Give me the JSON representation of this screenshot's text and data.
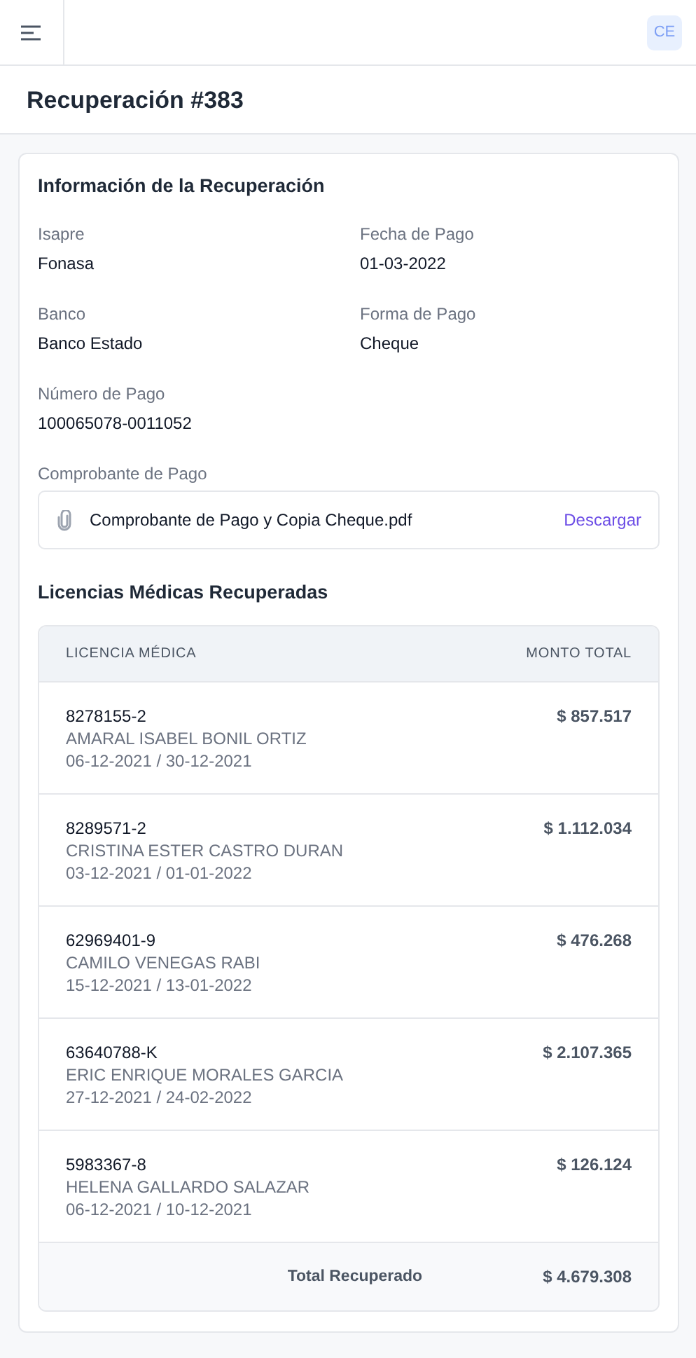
{
  "header": {
    "avatar": "CE"
  },
  "page_title": "Recuperación #383",
  "info": {
    "title": "Información de la Recuperación",
    "fields": [
      {
        "label": "Isapre",
        "value": "Fonasa"
      },
      {
        "label": "Fecha de Pago",
        "value": "01-03-2022"
      },
      {
        "label": "Banco",
        "value": "Banco Estado"
      },
      {
        "label": "Forma de Pago",
        "value": "Cheque"
      },
      {
        "label": "Número de Pago",
        "value": "100065078-0011052"
      }
    ],
    "attachment": {
      "label": "Comprobante de Pago",
      "file": "Comprobante de Pago y Copia Cheque.pdf",
      "action": "Descargar"
    }
  },
  "licenses": {
    "title": "Licencias Médicas Recuperadas",
    "columns": [
      "LICENCIA MÉDICA",
      "MONTO TOTAL"
    ],
    "rows": [
      {
        "id": "8278155-2",
        "name": "AMARAL ISABEL BONIL ORTIZ",
        "dates": "06-12-2021 / 30-12-2021",
        "amount": "$ 857.517"
      },
      {
        "id": "8289571-2",
        "name": "CRISTINA ESTER CASTRO DURAN",
        "dates": "03-12-2021 / 01-01-2022",
        "amount": "$ 1.112.034"
      },
      {
        "id": "62969401-9",
        "name": "CAMILO VENEGAS RABI",
        "dates": "15-12-2021 / 13-01-2022",
        "amount": "$ 476.268"
      },
      {
        "id": "63640788-K",
        "name": "ERIC ENRIQUE MORALES GARCIA",
        "dates": "27-12-2021 / 24-02-2022",
        "amount": "$ 2.107.365"
      },
      {
        "id": "5983367-8",
        "name": "HELENA GALLARDO SALAZAR",
        "dates": "06-12-2021 / 10-12-2021",
        "amount": "$ 126.124"
      }
    ],
    "total_label": "Total Recuperado",
    "total": "$ 4.679.308"
  }
}
